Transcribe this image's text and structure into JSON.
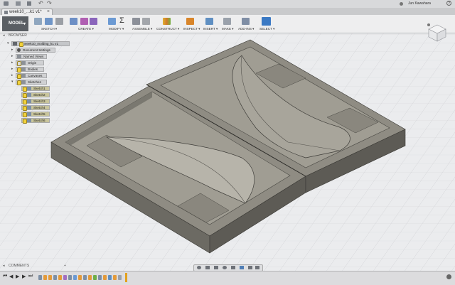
{
  "window": {
    "user_name": "Jun Kawahara",
    "doc_tab_title": "week10_...k1 v1*",
    "help_label": "?"
  },
  "ribbon": {
    "workspace": "MODEL",
    "groups": [
      {
        "key": "sketch",
        "label": "SKETCH ▾"
      },
      {
        "key": "create",
        "label": "CREATE ▾"
      },
      {
        "key": "modify",
        "label": "MODIFY ▾"
      },
      {
        "key": "assemble",
        "label": "ASSEMBLE ▾"
      },
      {
        "key": "construct",
        "label": "CONSTRUCT ▾"
      },
      {
        "key": "inspect",
        "label": "INSPECT ▾"
      },
      {
        "key": "insert",
        "label": "INSERT ▾"
      },
      {
        "key": "make",
        "label": "MAKE ▾"
      },
      {
        "key": "addins",
        "label": "ADD-INS ▾"
      },
      {
        "key": "select",
        "label": "SELECT ▾"
      }
    ]
  },
  "browser": {
    "header": "BROWSER",
    "root": "week10_molding_k1 v1",
    "items": [
      {
        "label": "Document Settings"
      },
      {
        "label": "Named Views"
      },
      {
        "label": "Origin"
      },
      {
        "label": "Bodies"
      },
      {
        "label": "Canvases"
      },
      {
        "label": "Sketches"
      }
    ],
    "sketches": [
      {
        "label": "Sketch1"
      },
      {
        "label": "Sketch2"
      },
      {
        "label": "Sketch3"
      },
      {
        "label": "Sketch4"
      },
      {
        "label": "Sketch5"
      },
      {
        "label": "Sketch6"
      }
    ]
  },
  "comments": {
    "header": "COMMENTS"
  },
  "colors": {
    "accent": "#f2d23b",
    "model_face_top": "#8d8a80",
    "model_face_side": "#6b6962",
    "ribbon_bg": "#eeeeef"
  }
}
